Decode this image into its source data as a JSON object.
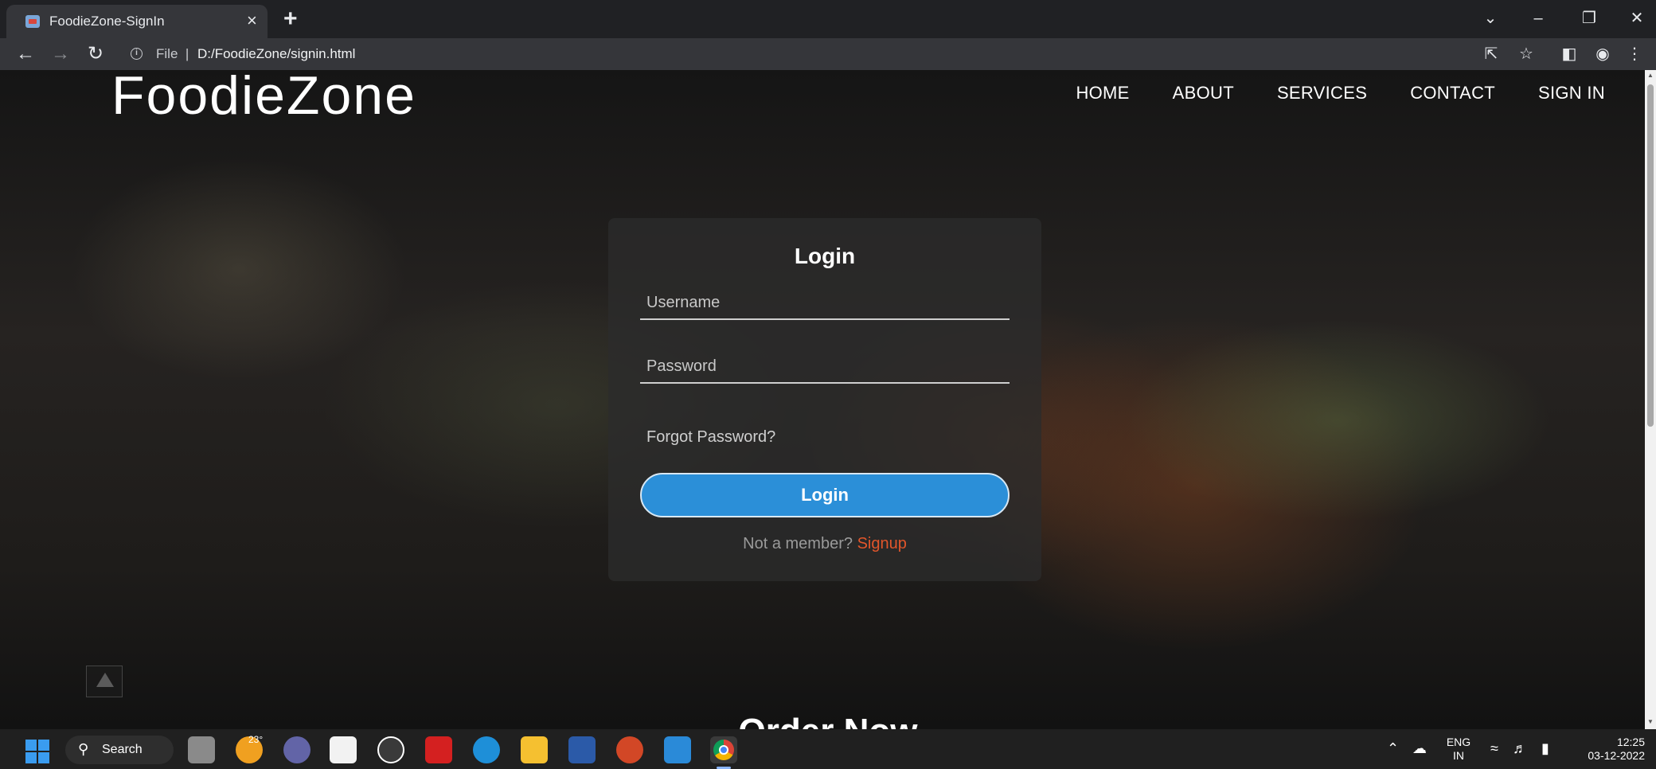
{
  "browser": {
    "tab_title": "FoodieZone-SignIn",
    "tab_close": "×",
    "new_tab": "+",
    "scheme_label": "File",
    "url": "D:/FoodieZone/signin.html"
  },
  "site": {
    "logo": "FoodieZone",
    "nav": [
      "HOME",
      "ABOUT",
      "SERVICES",
      "CONTACT",
      "SIGN IN"
    ]
  },
  "login": {
    "title": "Login",
    "username_placeholder": "Username",
    "password_placeholder": "Password",
    "forgot": "Forgot Password?",
    "button": "Login",
    "not_member": "Not a member?",
    "signup": "Signup"
  },
  "section": {
    "order_now": "Order Now"
  },
  "taskbar": {
    "search_label": "Search",
    "weather_temp": "23°",
    "lang_top": "ENG",
    "lang_bottom": "IN",
    "time": "12:25",
    "date": "03-12-2022"
  },
  "colors": {
    "accent_button": "#2b8fd8",
    "signup_link": "#e2562b"
  }
}
